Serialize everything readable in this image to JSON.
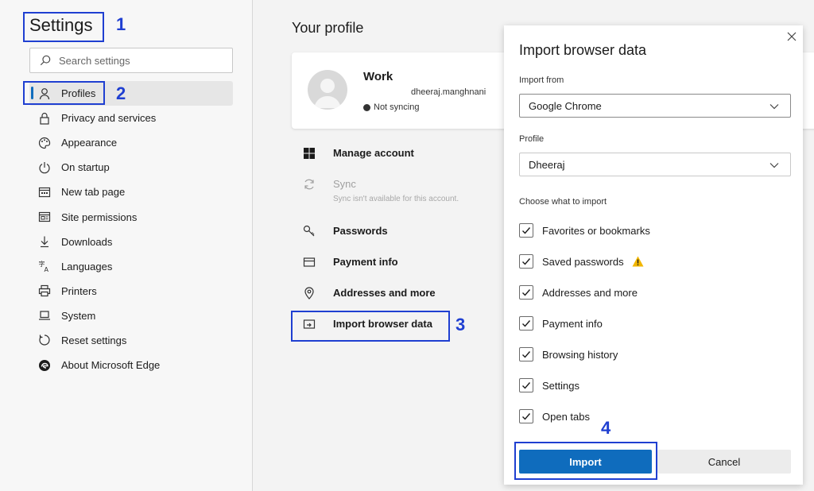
{
  "sidebar": {
    "title": "Settings",
    "search": {
      "placeholder": "Search settings",
      "icon": "search-icon"
    },
    "items": [
      {
        "label": "Profiles",
        "icon": "person-icon",
        "active": true
      },
      {
        "label": "Privacy and services",
        "icon": "lock-icon"
      },
      {
        "label": "Appearance",
        "icon": "palette-icon"
      },
      {
        "label": "On startup",
        "icon": "power-icon"
      },
      {
        "label": "New tab page",
        "icon": "new-tab-icon"
      },
      {
        "label": "Site permissions",
        "icon": "site-permissions-icon"
      },
      {
        "label": "Downloads",
        "icon": "download-icon"
      },
      {
        "label": "Languages",
        "icon": "languages-icon"
      },
      {
        "label": "Printers",
        "icon": "printer-icon"
      },
      {
        "label": "System",
        "icon": "laptop-icon"
      },
      {
        "label": "Reset settings",
        "icon": "reset-icon"
      },
      {
        "label": "About Microsoft Edge",
        "icon": "edge-logo-icon"
      }
    ]
  },
  "main": {
    "title": "Your profile",
    "profile": {
      "name": "Work",
      "email": "dheeraj.manghnani",
      "sync_status": "Not syncing"
    },
    "items": [
      {
        "label": "Manage account",
        "icon": "windows-icon"
      },
      {
        "label": "Sync",
        "sub": "Sync isn't available for this account.",
        "icon": "sync-icon",
        "disabled": true
      },
      {
        "label": "Passwords",
        "icon": "key-icon"
      },
      {
        "label": "Payment info",
        "icon": "card-icon"
      },
      {
        "label": "Addresses and more",
        "icon": "location-icon"
      },
      {
        "label": "Import browser data",
        "icon": "import-icon"
      }
    ]
  },
  "dialog": {
    "title": "Import browser data",
    "import_from_label": "Import from",
    "import_from_value": "Google Chrome",
    "profile_label": "Profile",
    "profile_value": "Dheeraj",
    "choose_label": "Choose what to import",
    "options": [
      {
        "label": "Favorites or bookmarks",
        "checked": true
      },
      {
        "label": "Saved passwords",
        "checked": true,
        "warning": true
      },
      {
        "label": "Addresses and more",
        "checked": true
      },
      {
        "label": "Payment info",
        "checked": true
      },
      {
        "label": "Browsing history",
        "checked": true
      },
      {
        "label": "Settings",
        "checked": true
      },
      {
        "label": "Open tabs",
        "checked": true
      }
    ],
    "import_button": "Import",
    "cancel_button": "Cancel"
  },
  "annotations": [
    "1",
    "2",
    "3",
    "4"
  ],
  "colors": {
    "accent": "#0f6cbd",
    "annotation": "#1f3fd1",
    "warning": "#f2b600"
  }
}
